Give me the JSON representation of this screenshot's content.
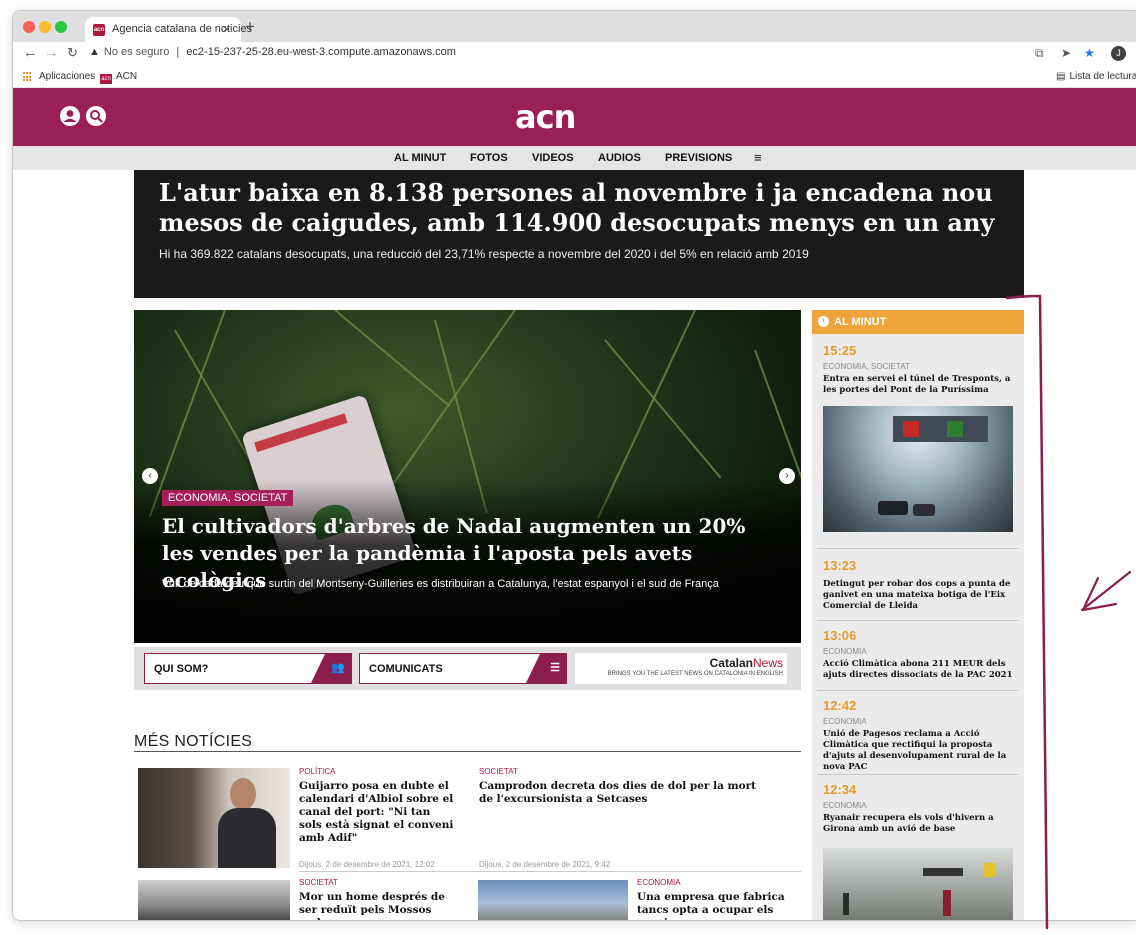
{
  "browser": {
    "tab_title": "Agencia catalana de noticies",
    "tab_close": "×",
    "new_tab": "+",
    "address_warning": "No es seguro",
    "address_separator": "|",
    "address_url": "ec2-15-237-25-28.eu-west-3.compute.amazonaws.com",
    "avatar_initial": "J",
    "bookmarks": [
      {
        "label": "Aplicaciones"
      },
      {
        "label": "ACN"
      }
    ],
    "reading_list": "Lista de lectura",
    "colors": {
      "close": "#ff5f57",
      "minimize": "#febc2e",
      "maximize": "#28c840"
    }
  },
  "site": {
    "logo": "acn",
    "brand_color": "#9a1f54",
    "nav": [
      "AL MINUT",
      "FOTOS",
      "VIDEOS",
      "AUDIOS",
      "PREVISIONS",
      "≡"
    ]
  },
  "top_story": {
    "title": "L'atur baixa en 8.138 persones al novembre i ja encadena nou mesos de caigudes, amb 114.900 desocupats menys en un any",
    "subtitle": "Hi ha 369.822 catalans desocupats, una reducció del 23,71% respecte a novembre del 2020 i del 5% en relació amb 2019"
  },
  "hero": {
    "category": "ECONOMIA, SOCIETAT",
    "title": "El cultivadors d'arbres de Nadal augmenten un 20% les vendes per la pandèmia i l'aposta pels avets ecològics",
    "subtitle": "Vuit de cada deu que surtin del Montseny-Guilleries es distribuiran a Catalunya, l'estat espanyol i el sud de França"
  },
  "promos": {
    "qui_som": "QUI SOM?",
    "comunicats": "COMUNICATS",
    "catalan_a": "Catalan",
    "catalan_b": "News",
    "catalan_tag": "BRINGS YOU THE LATEST NEWS ON CATALONIA IN ENGLISH"
  },
  "mes_noticies": {
    "heading": "MÉS NOTÍCIES",
    "items": [
      {
        "category": "POLÍTICA",
        "title": "Guijarro posa en dubte el calendari d'Albiol sobre el canal del port: \"Ni tan sols està signat el conveni amb Adif\"",
        "date": "Dijous, 2 de desembre de 2021, 12:02"
      },
      {
        "category": "SOCIETAT",
        "title": "Camprodon decreta dos dies de dol per la mort de l'excursionista a Setcases",
        "date": "Dijous, 2 de desembre de 2021, 9:42"
      },
      {
        "category": "SOCIETAT",
        "title": "Mor un home després de ser reduït pels Mossos amb una"
      },
      {
        "category": "ECONOMIA",
        "title": "Una empresa que fabrica tancs opta a ocupar els espais"
      }
    ]
  },
  "al_minut": {
    "heading": "AL MINUT",
    "items": [
      {
        "time": "15:25",
        "category": "ECONOMIA, SOCIETAT",
        "title": "Entra en servei el túnel de Tresponts, a les portes del Pont de la Puríssima"
      },
      {
        "time": "13:23",
        "category": "",
        "title": "Detingut per robar dos cops a punta de ganivet en una mateixa botiga de l'Eix Comercial de Lleida"
      },
      {
        "time": "13:06",
        "category": "ECONOMIA",
        "title": "Acció Climàtica abona 211 MEUR dels ajuts directes dissociats de la PAC 2021"
      },
      {
        "time": "12:42",
        "category": "ECONOMIA",
        "title": "Unió de Pagesos reclama a Acció Climàtica que rectifiqui la proposta d'ajuts al desenvolupament rural de la nova PAC"
      },
      {
        "time": "12:34",
        "category": "ECONOMIA",
        "title": "Ryanair recupera els vols d'hivern a Girona amb un avió de base"
      }
    ]
  }
}
